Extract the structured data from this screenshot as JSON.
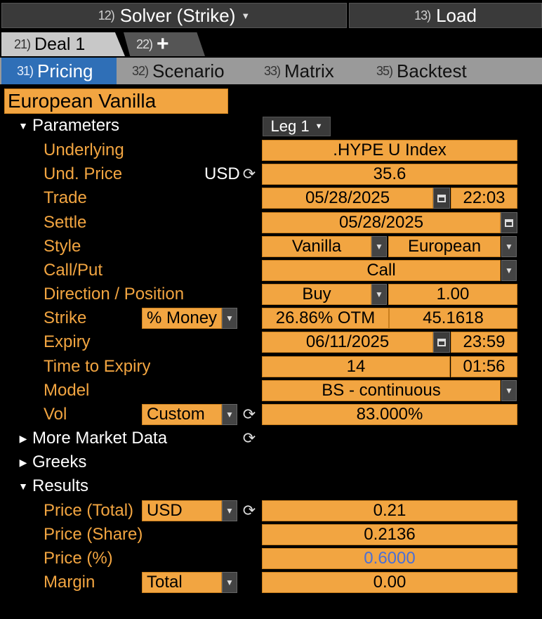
{
  "header": {
    "solver": {
      "num": "12)",
      "label": "Solver (Strike)"
    },
    "load": {
      "num": "13)",
      "label": "Load"
    }
  },
  "deal_tabs": [
    {
      "num": "21)",
      "label": "Deal 1"
    },
    {
      "num": "22)",
      "label": "+"
    }
  ],
  "sub_tabs": [
    {
      "num": "31)",
      "label": "Pricing"
    },
    {
      "num": "32)",
      "label": "Scenario"
    },
    {
      "num": "33)",
      "label": "Matrix"
    },
    {
      "num": "35)",
      "label": "Backtest"
    }
  ],
  "product_title": "European Vanilla",
  "sections": {
    "parameters": "Parameters",
    "more_market_data": "More Market Data",
    "greeks": "Greeks",
    "results": "Results"
  },
  "leg_selector": "Leg 1",
  "parameters": {
    "underlying": {
      "label": "Underlying",
      "value": ".HYPE U Index"
    },
    "und_price": {
      "label": "Und. Price",
      "currency": "USD",
      "value": "35.6"
    },
    "trade": {
      "label": "Trade",
      "date": "05/28/2025",
      "time": "22:03"
    },
    "settle": {
      "label": "Settle",
      "date": "05/28/2025"
    },
    "style": {
      "label": "Style",
      "type": "Vanilla",
      "exercise": "European"
    },
    "call_put": {
      "label": "Call/Put",
      "value": "Call"
    },
    "direction": {
      "label": "Direction / Position",
      "value": "Buy",
      "position": "1.00"
    },
    "strike": {
      "label": "Strike",
      "mode": "% Money",
      "moneyness": "26.86% OTM",
      "value": "45.1618"
    },
    "expiry": {
      "label": "Expiry",
      "date": "06/11/2025",
      "time": "23:59"
    },
    "time_to_expiry": {
      "label": "Time to Expiry",
      "days": "14",
      "time": "01:56"
    },
    "model": {
      "label": "Model",
      "value": "BS - continuous"
    },
    "vol": {
      "label": "Vol",
      "mode": "Custom",
      "value": "83.000%"
    }
  },
  "results": {
    "price_total": {
      "label": "Price (Total)",
      "currency": "USD",
      "value": "0.21"
    },
    "price_share": {
      "label": "Price (Share)",
      "value": "0.2136"
    },
    "price_pct": {
      "label": "Price (%)",
      "value": "0.6000"
    },
    "margin": {
      "label": "Margin",
      "mode": "Total",
      "value": "0.00"
    }
  },
  "colors": {
    "accent_orange": "#f2a541",
    "active_tab_blue": "#2f6fb7",
    "price_pct_text": "#4a6fd6"
  }
}
